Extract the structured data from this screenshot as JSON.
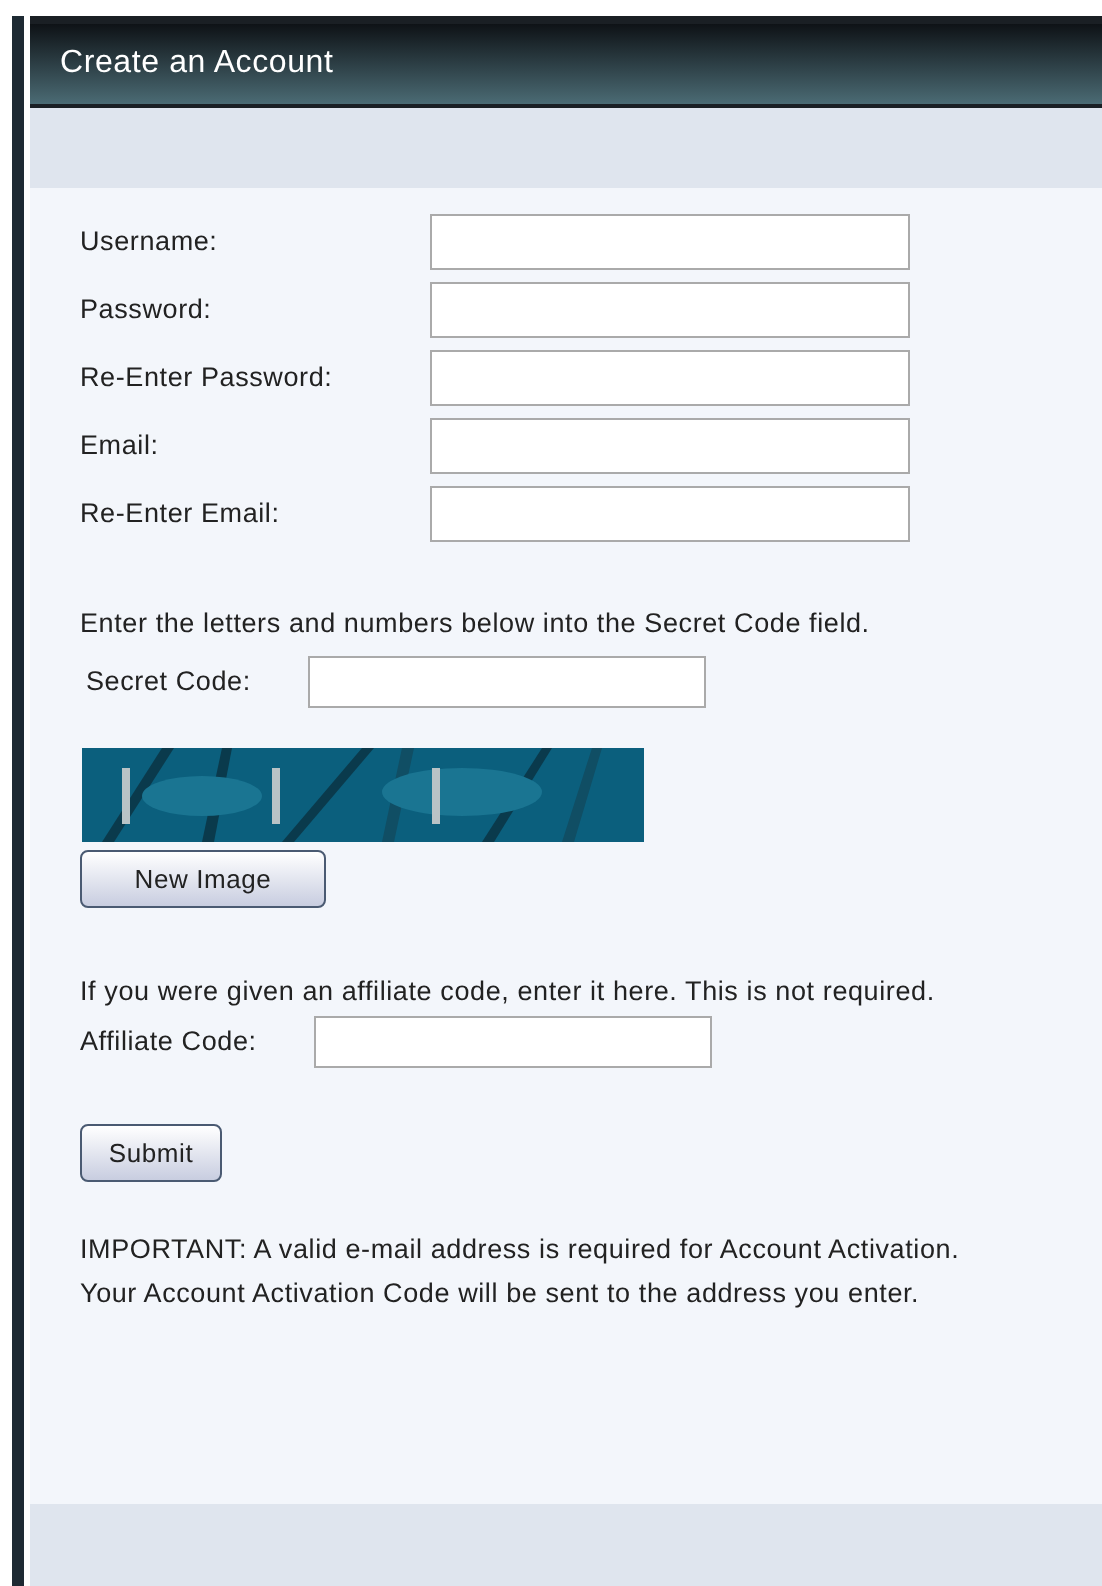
{
  "header": {
    "title": "Create an Account"
  },
  "fields": [
    {
      "label": "Username:"
    },
    {
      "label": "Password:"
    },
    {
      "label": "Re-Enter Password:"
    },
    {
      "label": "Email:"
    },
    {
      "label": "Re-Enter Email:"
    }
  ],
  "captcha": {
    "instruction": "Enter the letters and numbers below into the Secret Code field.",
    "label": "Secret Code:",
    "new_image_button": "New Image"
  },
  "affiliate": {
    "note": "If you were given an affiliate code, enter it here. This is not required.",
    "label": "Affiliate Code:"
  },
  "submit_button": "Submit",
  "notice": "IMPORTANT: A valid e-mail address is required for Account Activation. Your Account Activation Code will be sent to the address you enter."
}
